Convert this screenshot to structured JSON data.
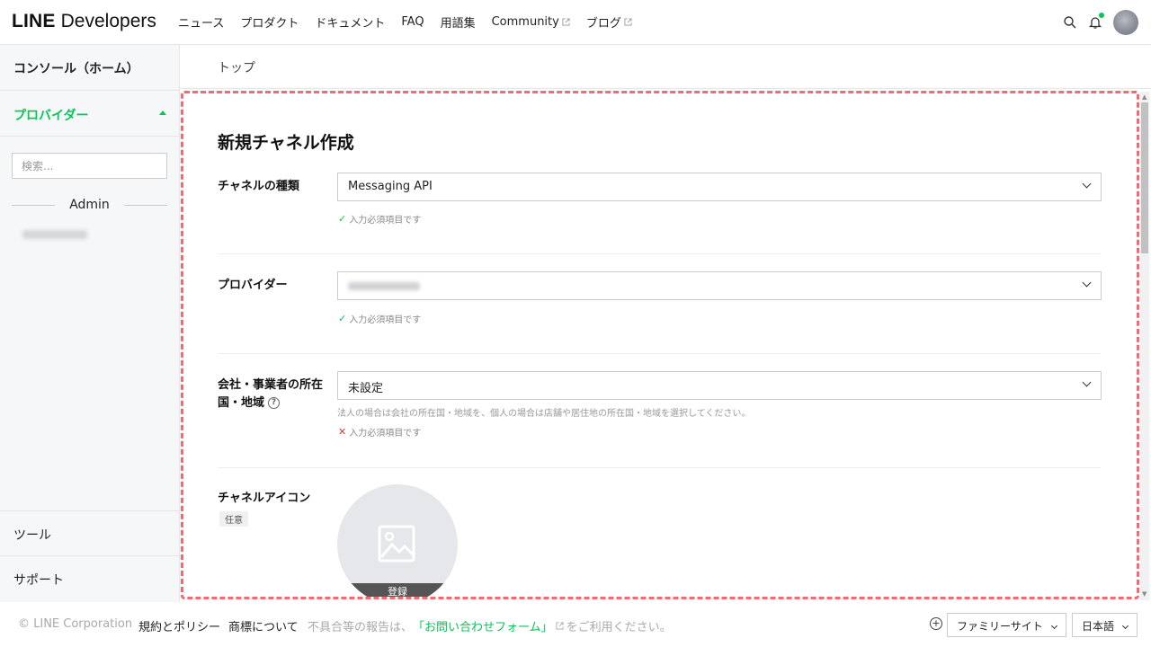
{
  "header": {
    "logo_bold": "LINE",
    "logo_text": "Developers",
    "nav": [
      {
        "label": "ニュース",
        "external": false
      },
      {
        "label": "プロダクト",
        "external": false
      },
      {
        "label": "ドキュメント",
        "external": false
      },
      {
        "label": "FAQ",
        "external": false
      },
      {
        "label": "用語集",
        "external": false
      },
      {
        "label": "Community",
        "external": true
      },
      {
        "label": "ブログ",
        "external": true
      }
    ]
  },
  "sidebar": {
    "home": "コンソール（ホーム）",
    "providers": "プロバイダー",
    "search_placeholder": "検索...",
    "admin": "Admin",
    "tools": "ツール",
    "support": "サポート"
  },
  "breadcrumb": "トップ",
  "form": {
    "title": "新規チャネル作成",
    "channel_type": {
      "label": "チャネルの種類",
      "value": "Messaging API",
      "status": "入力必須項目です"
    },
    "provider": {
      "label": "プロバイダー",
      "status": "入力必須項目です"
    },
    "country": {
      "label_line1": "会社・事業者の所在",
      "label_line2": "国・地域",
      "value": "未設定",
      "hint": "法人の場合は会社の所在国・地域を、個人の場合は店舗や居住地の所在国・地域を選択してください。",
      "status": "入力必須項目です"
    },
    "icon": {
      "label": "チャネルアイコン",
      "badge": "任意",
      "register": "登録"
    }
  },
  "footer": {
    "copyright": "© LINE Corporation",
    "terms": "規約とポリシー",
    "trademark": "商標について",
    "report_prefix": "不具合等の報告は、",
    "report_link": "「お問い合わせフォーム」",
    "report_suffix": "をご利用ください。",
    "family_sites": "ファミリーサイト",
    "language": "日本語"
  },
  "colors": {
    "brand_green": "#06c755",
    "highlight_dashed": "#f06b73",
    "error_red": "#e0393e"
  }
}
